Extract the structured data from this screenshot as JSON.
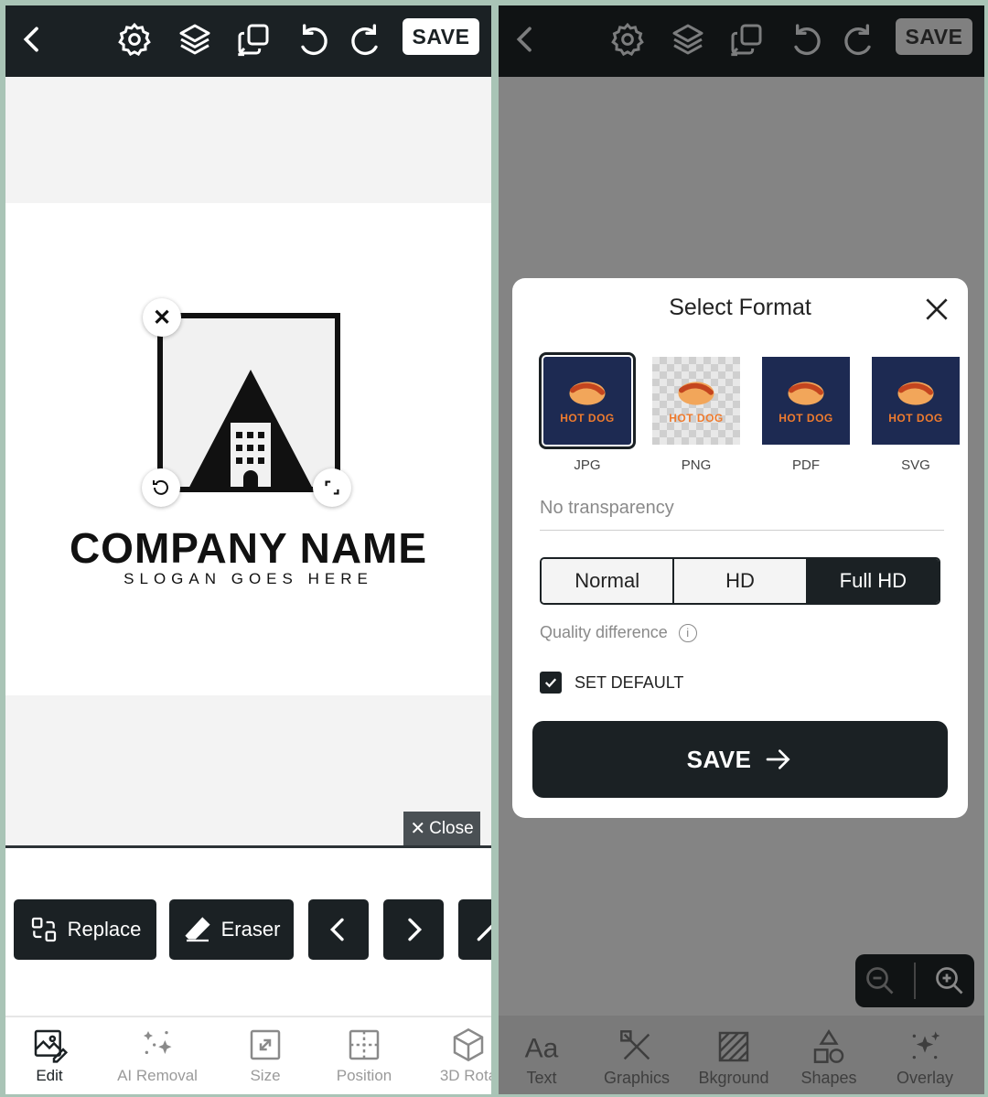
{
  "toolbar": {
    "save_label": "SAVE"
  },
  "left": {
    "canvas": {
      "company_name": "COMPANY NAME",
      "slogan": "SLOGAN GOES HERE",
      "close_label": "Close"
    },
    "tools": [
      {
        "label": "Replace",
        "icon": "replace-icon"
      },
      {
        "label": "Eraser",
        "icon": "eraser-icon"
      }
    ],
    "nav": [
      {
        "label": "Edit",
        "icon": "edit-image-icon",
        "active": true
      },
      {
        "label": "AI Removal",
        "icon": "sparkles-icon"
      },
      {
        "label": "Size",
        "icon": "resize-icon"
      },
      {
        "label": "Position",
        "icon": "position-icon"
      },
      {
        "label": "3D Rota",
        "icon": "cube-icon"
      }
    ]
  },
  "right": {
    "modal": {
      "title": "Select Format",
      "formats": [
        {
          "label": "JPG",
          "selected": true
        },
        {
          "label": "PNG"
        },
        {
          "label": "PDF"
        },
        {
          "label": "SVG"
        }
      ],
      "thumb_text": "HOT DOG",
      "transparency_placeholder": "No transparency",
      "quality_options": [
        {
          "label": "Normal"
        },
        {
          "label": "HD"
        },
        {
          "label": "Full HD",
          "active": true
        }
      ],
      "quality_diff_label": "Quality difference",
      "set_default_label": "SET DEFAULT",
      "save_label": "SAVE"
    },
    "nav": [
      {
        "label": "Text",
        "icon": "text-icon"
      },
      {
        "label": "Graphics",
        "icon": "graphics-icon"
      },
      {
        "label": "Bkground",
        "icon": "background-icon"
      },
      {
        "label": "Shapes",
        "icon": "shapes-icon"
      },
      {
        "label": "Overlay",
        "icon": "overlay-icon"
      }
    ]
  },
  "colors": {
    "dark": "#1b2124",
    "accent_orange": "#ef7b2e",
    "thumb_navy": "#1d2a52"
  }
}
